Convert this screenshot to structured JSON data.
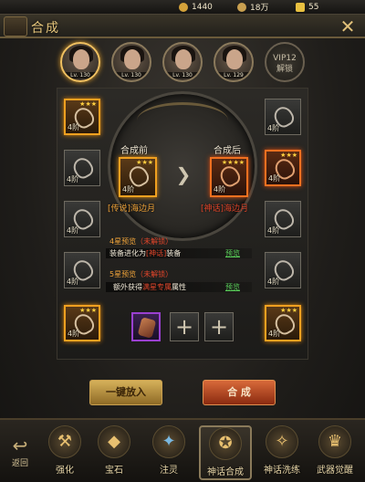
{
  "resources": [
    {
      "icon": "star-coin-icon",
      "value": "1440",
      "color": "#d4a23a"
    },
    {
      "icon": "copper-coin-icon",
      "value": "18万",
      "color": "#c9a050"
    },
    {
      "icon": "gold-ingot-icon",
      "value": "55",
      "color": "#e8c040"
    }
  ],
  "title": "合成",
  "heroes": [
    {
      "lv": "Lv. 130",
      "active": true
    },
    {
      "lv": "Lv. 130",
      "active": false
    },
    {
      "lv": "Lv. 130",
      "active": false
    },
    {
      "lv": "Lv. 129",
      "active": false
    }
  ],
  "vip": {
    "line1": "VIP12",
    "line2": "解锁"
  },
  "slots_left": [
    {
      "tier": "4阶",
      "stars": "★★★",
      "style": "gold"
    },
    {
      "tier": "4阶",
      "stars": "",
      "style": "plain"
    },
    {
      "tier": "4阶",
      "stars": "",
      "style": "plain"
    },
    {
      "tier": "4阶",
      "stars": "",
      "style": "plain"
    },
    {
      "tier": "4阶",
      "stars": "★★★",
      "style": "gold"
    }
  ],
  "slots_right": [
    {
      "tier": "4阶",
      "stars": "",
      "style": "plain"
    },
    {
      "tier": "4阶",
      "stars": "★★★",
      "style": "red"
    },
    {
      "tier": "4阶",
      "stars": "",
      "style": "plain"
    },
    {
      "tier": "4阶",
      "stars": "",
      "style": "plain"
    },
    {
      "tier": "4阶",
      "stars": "★★★",
      "style": "gold"
    }
  ],
  "before": {
    "caption": "合成前",
    "tier": "4阶",
    "stars": "★★★",
    "name_prefix": "[传说]",
    "name": "海边月"
  },
  "after": {
    "caption": "合成后",
    "tier": "4阶",
    "stars": "★★★★",
    "name_prefix": "[神话]",
    "name": "海边月"
  },
  "info": {
    "line1_a": "4星预览",
    "line1_b": "（未解锁）",
    "line2_a": "装备进化为",
    "line2_b": "[神话]",
    "line2_c": "装备",
    "preview1": "预览",
    "line3_a": "5星预览",
    "line3_b": "（未解锁）",
    "line4_a": "额外获得",
    "line4_b": "满星专属",
    "line4_c": "属性",
    "preview2": "预览"
  },
  "materials": [
    {
      "type": "gem"
    },
    {
      "type": "add"
    },
    {
      "type": "add"
    }
  ],
  "buttons": {
    "auto": "一键放入",
    "compose": "合 成"
  },
  "bottom": {
    "back": "返回",
    "nav": [
      {
        "label": "强化",
        "icon": "hammer-icon"
      },
      {
        "label": "宝石",
        "icon": "gem-icon"
      },
      {
        "label": "注灵",
        "icon": "spirit-icon"
      },
      {
        "label": "神话合成",
        "icon": "compose-icon"
      },
      {
        "label": "神话洗练",
        "icon": "refine-icon"
      },
      {
        "label": "武器觉醒",
        "icon": "awaken-icon"
      }
    ]
  }
}
